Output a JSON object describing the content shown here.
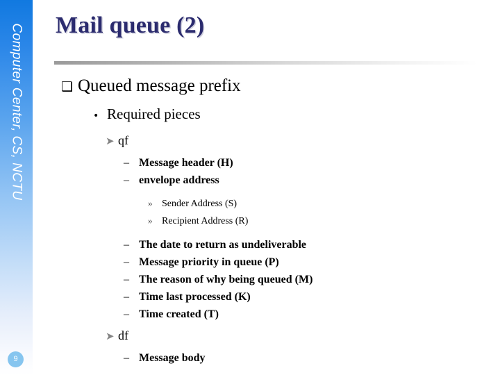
{
  "slide": {
    "title": "Mail queue (2)",
    "page_number": "9",
    "sidebar_text": "Computer Center, CS, NCTU",
    "accent_color": "#2b2b6e",
    "sidebar_gradient_from": "#1179e0",
    "sidebar_gradient_to": "#ffffff",
    "badge_color": "#86c5ef"
  },
  "bullets": {
    "square_glyph": "❑",
    "disc_glyph": "•",
    "arrow_glyph": "➤",
    "dash_glyph": "–",
    "guillemet_glyph": "»"
  },
  "outline": {
    "l1_queued_message_prefix": "Queued message prefix",
    "l2_required_pieces": "Required pieces",
    "l3_qf": "qf",
    "l4_message_header": "Message header (H)",
    "l4_envelope_address": "envelope address",
    "l5_sender_address": "Sender Address (S)",
    "l5_recipient_address": "Recipient Address (R)",
    "l4_date_to_return": "The date to return as undeliverable",
    "l4_message_priority": "Message priority in queue (P)",
    "l4_reason_queued": "The reason of why being queued (M)",
    "l4_time_last_processed": "Time last processed (K)",
    "l4_time_created": "Time created (T)",
    "l3_df": "df",
    "l4_message_body": "Message body"
  }
}
